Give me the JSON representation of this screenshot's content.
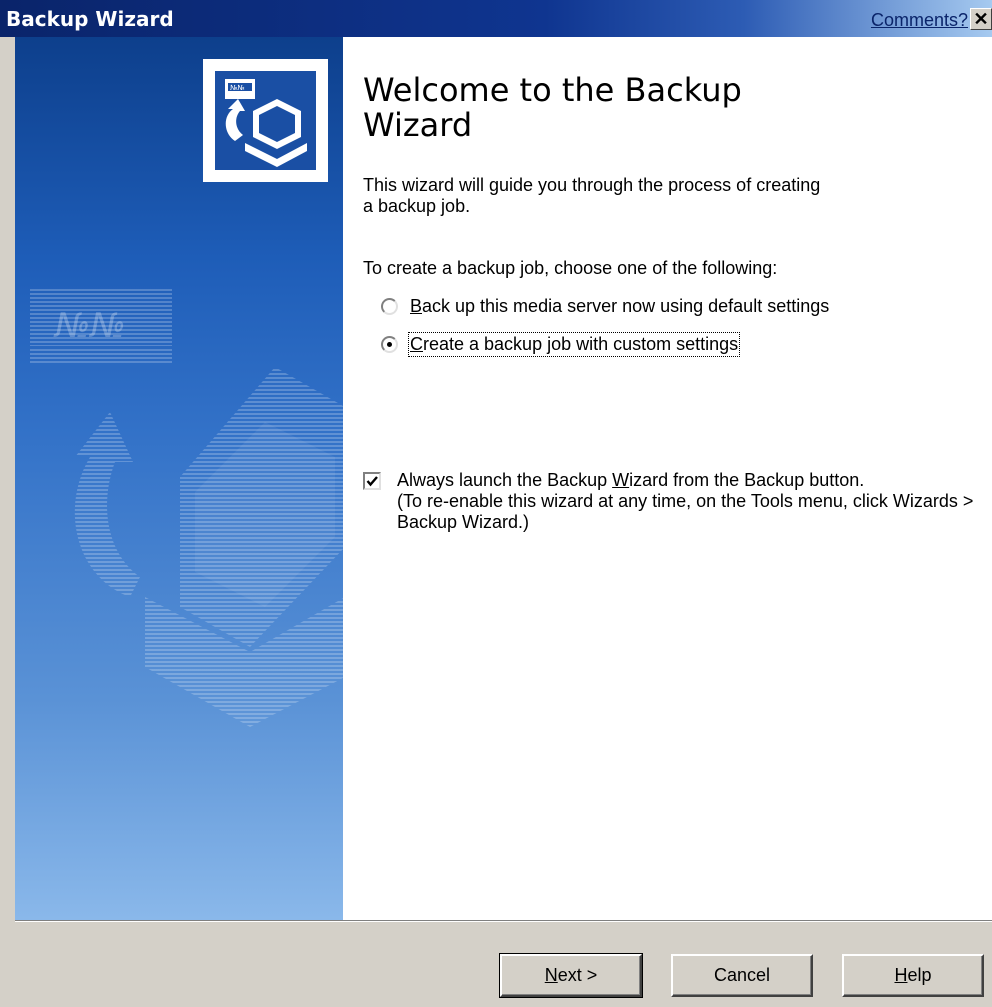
{
  "window": {
    "title": "Backup Wizard",
    "comments_link": "Comments?",
    "close_glyph": "✕"
  },
  "content": {
    "heading": "Welcome to the Backup Wizard",
    "intro": "This wizard will guide you through the process of creating a backup job.",
    "prompt": "To create a backup job, choose one of the following:",
    "options": [
      {
        "mnemonic": "B",
        "rest": "ack up this media server now using default settings",
        "selected": false
      },
      {
        "mnemonic": "C",
        "rest": "reate a backup job with custom settings",
        "selected": true
      }
    ],
    "always_launch": {
      "checked": true,
      "line1_before": "Always launch the Backup ",
      "line1_mnemonic": "W",
      "line1_after": "izard from the Backup button.",
      "line2": "(To re-enable this wizard at any time, on the Tools menu, click Wizards > Backup Wizard.)"
    }
  },
  "buttons": {
    "next_mnemonic": "N",
    "next_rest": "ext >",
    "cancel": "Cancel",
    "help_mnemonic": "H",
    "help_rest": "elp"
  },
  "icons": {
    "logo": "backup-computer-icon",
    "watermark": "backup-computer-watermark"
  },
  "colors": {
    "title_bar": "#0a246a",
    "banner": "#1e5db8",
    "dialog_bg": "#d4d0c8"
  }
}
